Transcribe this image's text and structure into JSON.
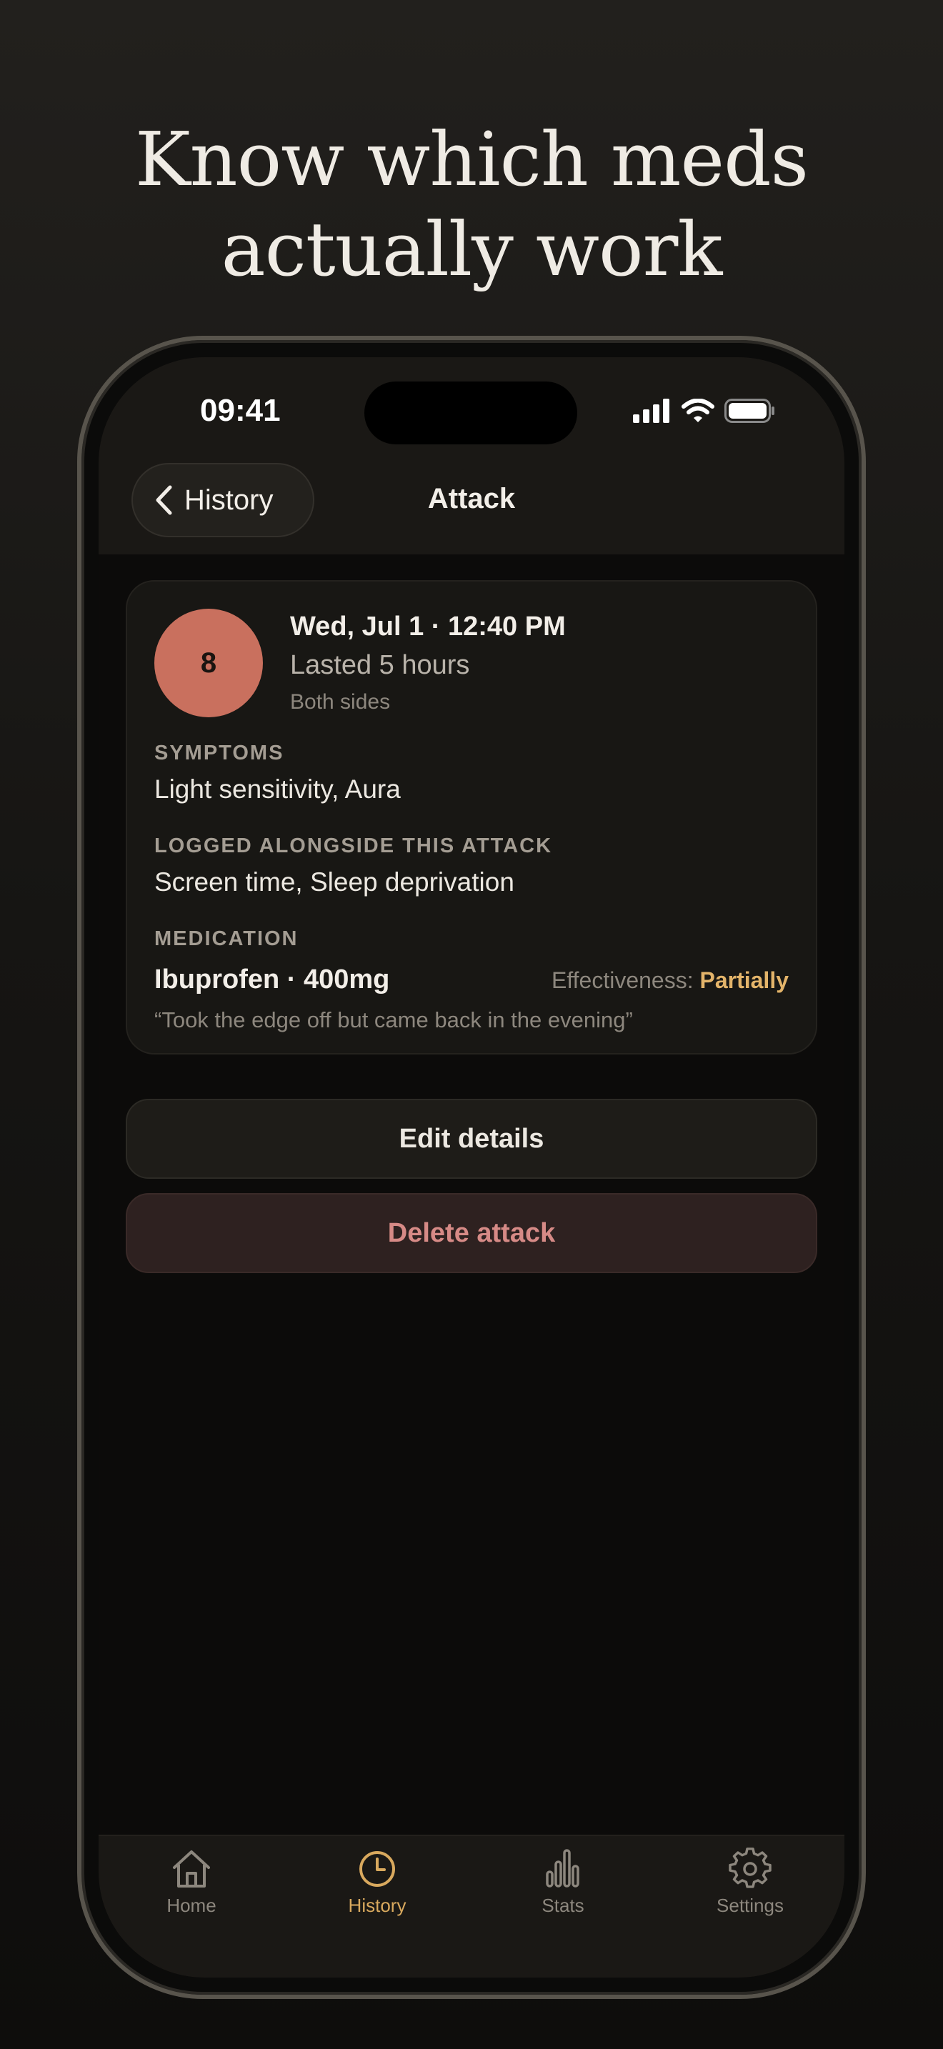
{
  "headline": {
    "line1": "Know which meds",
    "line2": "actually work"
  },
  "status_bar": {
    "time": "09:41"
  },
  "nav": {
    "back_label": "History",
    "title": "Attack"
  },
  "attack": {
    "severity": "8",
    "datetime": "Wed, Jul 1 · 12:40 PM",
    "duration": "Lasted 5 hours",
    "location": "Both sides",
    "symptoms_label": "SYMPTOMS",
    "symptoms": "Light sensitivity, Aura",
    "logged_label": "LOGGED ALONGSIDE THIS ATTACK",
    "logged": "Screen time, Sleep deprivation",
    "medication_label": "MEDICATION",
    "medication": "Ibuprofen · 400mg",
    "effectiveness_label": "Effectiveness:",
    "effectiveness_value": "Partially",
    "note": "“Took the edge off but came back in the evening”"
  },
  "actions": {
    "edit": "Edit details",
    "delete": "Delete attack"
  },
  "tabs": [
    {
      "label": "Home",
      "icon": "house-icon",
      "active": false
    },
    {
      "label": "History",
      "icon": "clock-icon",
      "active": true
    },
    {
      "label": "Stats",
      "icon": "bar-chart-icon",
      "active": false
    },
    {
      "label": "Settings",
      "icon": "gear-icon",
      "active": false
    }
  ],
  "colors": {
    "severity": "#c9705e",
    "accent": "#d9a95e",
    "effectiveness": "#e3b46a",
    "danger_text": "#d68a86"
  }
}
